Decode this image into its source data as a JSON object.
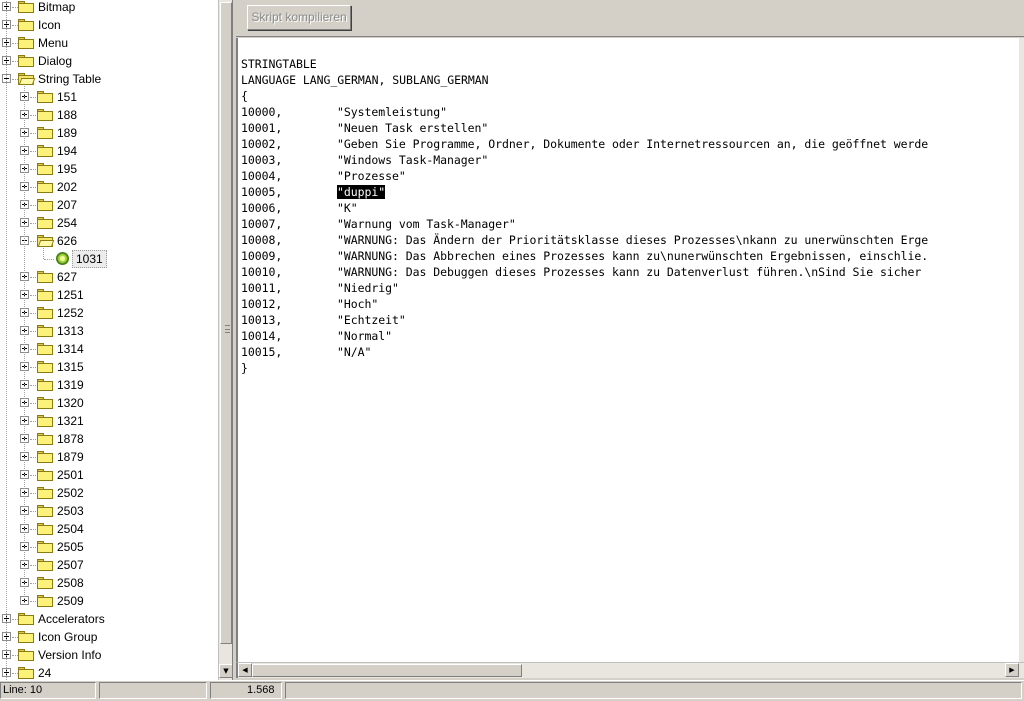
{
  "tree": {
    "top_items": [
      {
        "label": "Bitmap"
      },
      {
        "label": "Icon"
      },
      {
        "label": "Menu"
      },
      {
        "label": "Dialog"
      }
    ],
    "string_table": {
      "label": "String Table",
      "children_before": [
        "151",
        "188",
        "189",
        "194",
        "195",
        "202",
        "207",
        "254"
      ],
      "open_child": {
        "label": "626",
        "leaf": "1031"
      },
      "children_after": [
        "627",
        "1251",
        "1252",
        "1313",
        "1314",
        "1315",
        "1319",
        "1320",
        "1321",
        "1878",
        "1879",
        "2501",
        "2502",
        "2503",
        "2504",
        "2505",
        "2507",
        "2508",
        "2509"
      ]
    },
    "bottom_items": [
      {
        "label": "Accelerators"
      },
      {
        "label": "Icon Group"
      },
      {
        "label": "Version Info"
      },
      {
        "label": "24"
      }
    ]
  },
  "toolbar": {
    "compile_label": "Skript kompilieren"
  },
  "editor": {
    "header_lines": [
      "STRINGTABLE",
      "LANGUAGE LANG_GERMAN, SUBLANG_GERMAN",
      "{"
    ],
    "entries": [
      {
        "id": "10000,",
        "text": "\"Systemleistung\""
      },
      {
        "id": "10001,",
        "text": "\"Neuen Task erstellen\""
      },
      {
        "id": "10002,",
        "text": "\"Geben Sie Programme, Ordner, Dokumente oder Internetressourcen an, die geöffnet werde"
      },
      {
        "id": "10003,",
        "text": "\"Windows Task-Manager\""
      },
      {
        "id": "10004,",
        "text": "\"Prozesse\""
      },
      {
        "id": "10005,",
        "text": "\"duppi\"",
        "highlighted": true
      },
      {
        "id": "10006,",
        "text": "\"K\""
      },
      {
        "id": "10007,",
        "text": "\"Warnung vom Task-Manager\""
      },
      {
        "id": "10008,",
        "text": "\"WARNUNG: Das Ändern der Prioritätsklasse dieses Prozesses\\nkann zu unerwünschten Erge"
      },
      {
        "id": "10009,",
        "text": "\"WARNUNG: Das Abbrechen eines Prozesses kann zu\\nunerwünschten Ergebnissen, einschlie."
      },
      {
        "id": "10010,",
        "text": "\"WARNUNG: Das Debuggen dieses Prozesses kann zu Datenverlust führen.\\nSind Sie sicher"
      },
      {
        "id": "10011,",
        "text": "\"Niedrig\""
      },
      {
        "id": "10012,",
        "text": "\"Hoch\""
      },
      {
        "id": "10013,",
        "text": "\"Echtzeit\""
      },
      {
        "id": "10014,",
        "text": "\"Normal\""
      },
      {
        "id": "10015,",
        "text": "\"N/A\""
      }
    ],
    "footer_lines": [
      "}"
    ]
  },
  "statusbar": {
    "line": "Line: 10",
    "empty": "",
    "size": "1.568"
  }
}
